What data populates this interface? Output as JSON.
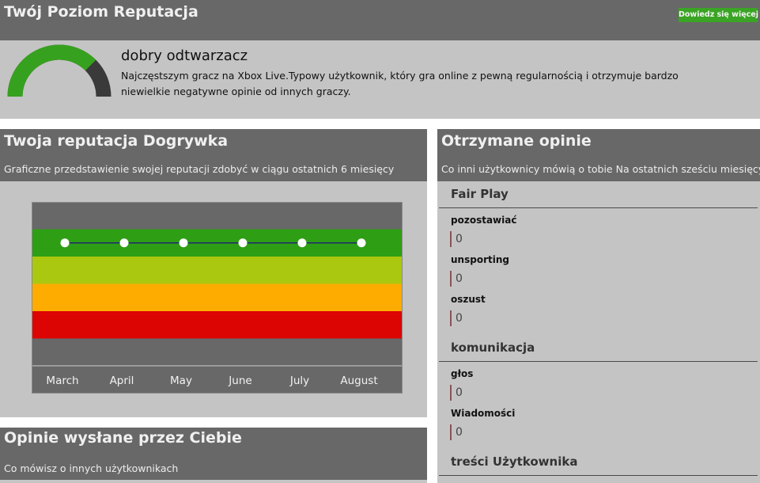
{
  "overview": {
    "title": "Twój Poziom Reputacja",
    "more_button": "Dowiedz się więcej",
    "level": "dobry odtwarzacz",
    "description": "Najczęstszym gracz na Xbox Live.Typowy użytkownik, który gra online z pewną regularnością i otrzymuje bardzo niewielkie negatywne opinie od innych graczy.",
    "gauge_fill_fraction": 0.75,
    "gauge_colors": {
      "fill": "#36a11e",
      "rest": "#3a3a3a"
    }
  },
  "reputation": {
    "title": "Twoja reputacja Dogrywka",
    "subtitle": "Graficzne przedstawienie swojej reputacji zdobyć w ciągu ostatnich 6 miesięcy"
  },
  "chart_data": {
    "type": "line",
    "categories": [
      "March",
      "April",
      "May",
      "June",
      "July",
      "August"
    ],
    "values": [
      4,
      4,
      4,
      4,
      4,
      4
    ],
    "bands": [
      {
        "level": 5,
        "color": "#686868"
      },
      {
        "level": 4,
        "color": "#2e9e15"
      },
      {
        "level": 3,
        "color": "#aac80f"
      },
      {
        "level": 2,
        "color": "#ffac00"
      },
      {
        "level": 1,
        "color": "#dd0404"
      },
      {
        "level": 0,
        "color": "#686868"
      }
    ],
    "line_color": "#1c2a6a",
    "point_color": "#ffffff"
  },
  "sent": {
    "title": "Opinie wysłane przez Ciebie",
    "subtitle": "Co mówisz o innych użytkownikach"
  },
  "received": {
    "title": "Otrzymane opinie",
    "subtitle": "Co inni użytkownicy mówią o tobie Na ostatnich sześciu miesięcy",
    "fair_play": {
      "label": "Fair Play",
      "items": [
        {
          "label": "pozostawiać",
          "value": "0"
        },
        {
          "label": "unsporting",
          "value": "0"
        },
        {
          "label": "oszust",
          "value": "0"
        }
      ]
    },
    "communication": {
      "label": "komunikacja",
      "items": [
        {
          "label": "głos",
          "value": "0"
        },
        {
          "label": "Wiadomości",
          "value": "0"
        }
      ]
    },
    "user_content": {
      "label": "treści Użytkownika"
    }
  }
}
